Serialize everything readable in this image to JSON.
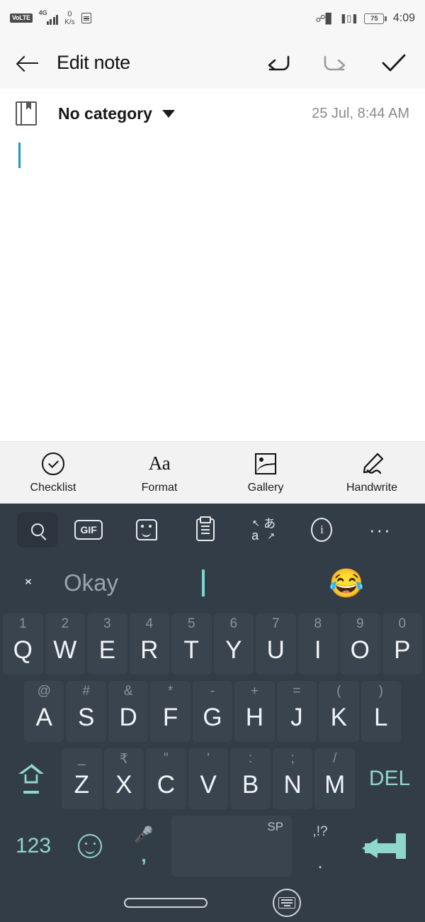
{
  "status_bar": {
    "volte_label": "VoLTE",
    "network_type": "4G",
    "net_speed_value": "0",
    "net_speed_unit": "K/s",
    "sim_icon": "sim-card-icon",
    "bluetooth_icon": "bluetooth-icon",
    "vibrate_icon": "vibrate-icon",
    "battery_percent": "75",
    "time": "4:09"
  },
  "app_bar": {
    "back_icon": "back-arrow-icon",
    "title": "Edit note",
    "undo_icon": "undo-icon",
    "redo_icon": "redo-icon",
    "done_icon": "checkmark-icon"
  },
  "category_row": {
    "book_icon": "notebook-icon",
    "category": "No category",
    "caret_icon": "chevron-down-icon",
    "timestamp": "25 Jul, 8:44 AM"
  },
  "note_body": {
    "text": "",
    "cursor_color": "#2196c4"
  },
  "note_toolbar": {
    "items": [
      {
        "icon": "checklist-icon",
        "label": "Checklist"
      },
      {
        "icon": "format-text-icon",
        "label": "Format",
        "glyph": "Aa"
      },
      {
        "icon": "gallery-image-icon",
        "label": "Gallery"
      },
      {
        "icon": "handwrite-pen-icon",
        "label": "Handwrite",
        "glyph": "✐"
      }
    ]
  },
  "keyboard": {
    "toolbar": [
      {
        "name": "search-icon",
        "label": "",
        "selected": true
      },
      {
        "name": "gif-icon",
        "label": "GIF"
      },
      {
        "name": "sticker-icon",
        "label": ""
      },
      {
        "name": "clipboard-icon",
        "label": ""
      },
      {
        "name": "translate-icon",
        "label": "",
        "latin": "a",
        "japanese": "あ"
      },
      {
        "name": "info-icon",
        "label": "i"
      },
      {
        "name": "more-options-icon",
        "label": "···"
      }
    ],
    "suggestions": {
      "collapse_icon": "collapse-chevrons-icon",
      "word": "Okay",
      "cursor": "|",
      "emoji": "😂"
    },
    "row1": [
      {
        "alt": "1",
        "main": "Q"
      },
      {
        "alt": "2",
        "main": "W"
      },
      {
        "alt": "3",
        "main": "E"
      },
      {
        "alt": "4",
        "main": "R"
      },
      {
        "alt": "5",
        "main": "T"
      },
      {
        "alt": "6",
        "main": "Y"
      },
      {
        "alt": "7",
        "main": "U"
      },
      {
        "alt": "8",
        "main": "I"
      },
      {
        "alt": "9",
        "main": "O"
      },
      {
        "alt": "0",
        "main": "P"
      }
    ],
    "row2": [
      {
        "alt": "@",
        "main": "A"
      },
      {
        "alt": "#",
        "main": "S"
      },
      {
        "alt": "&",
        "main": "D"
      },
      {
        "alt": "*",
        "main": "F"
      },
      {
        "alt": "-",
        "main": "G"
      },
      {
        "alt": "+",
        "main": "H"
      },
      {
        "alt": "=",
        "main": "J"
      },
      {
        "alt": "(",
        "main": "K"
      },
      {
        "alt": ")",
        "main": "L"
      }
    ],
    "row3": {
      "shift_icon": "shift-caps-icon",
      "keys": [
        {
          "alt": "_",
          "main": "Z"
        },
        {
          "alt": "₹",
          "main": "X"
        },
        {
          "alt": "\"",
          "main": "C"
        },
        {
          "alt": "'",
          "main": "V"
        },
        {
          "alt": ":",
          "main": "B"
        },
        {
          "alt": ";",
          "main": "N"
        },
        {
          "alt": "/",
          "main": "M"
        }
      ],
      "delete_label": "DEL"
    },
    "row4": {
      "numbers_label": "123",
      "emoji_icon": "emoji-smiley-icon",
      "mic_icon": "microphone-icon",
      "comma": ",",
      "space_label": "SP",
      "punct_top": ",!?",
      "punct_bottom": ".",
      "enter_icon": "enter-return-icon"
    },
    "accent_color": "#8fd6cd",
    "bg_color": "#333d47",
    "key_color": "#3a444f"
  },
  "nav_bar": {
    "home_icon": "home-pill-icon",
    "hide_keyboard_icon": "hide-keyboard-icon"
  }
}
